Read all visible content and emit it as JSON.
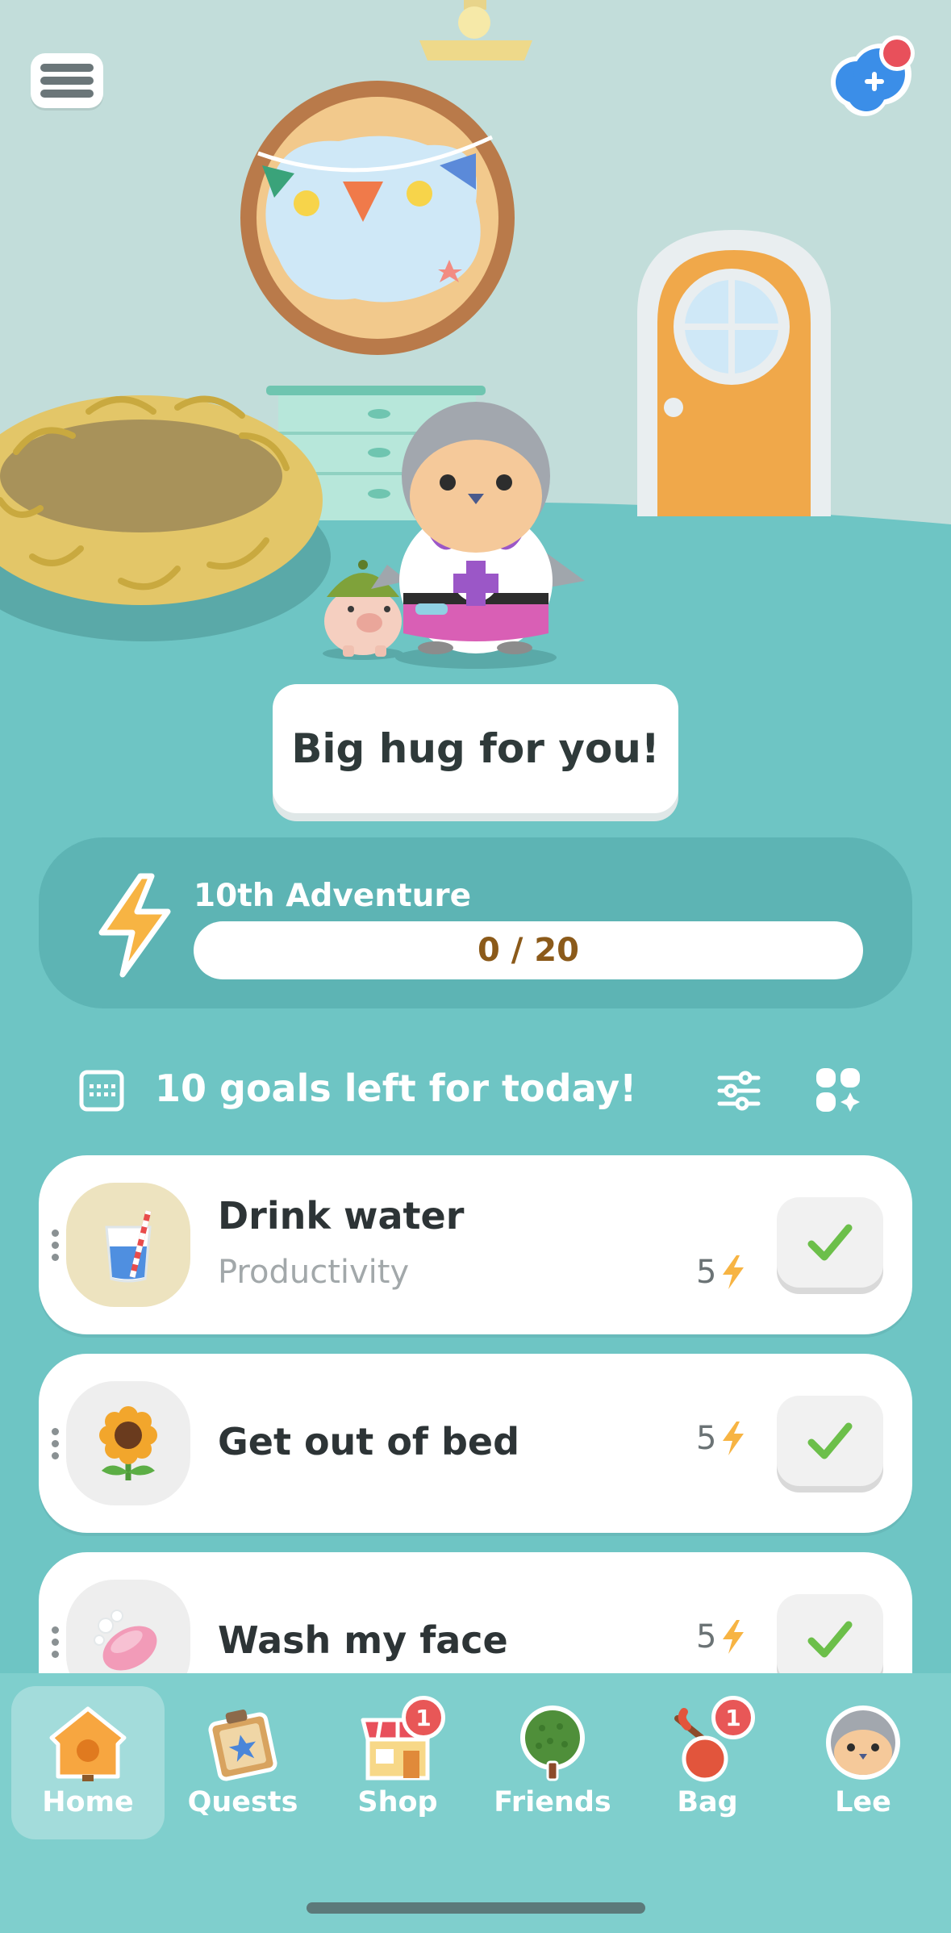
{
  "scene": {
    "speech_bubble": "Big hug for you!"
  },
  "adventure": {
    "title": "10th Adventure",
    "progress_label": "0 / 20",
    "progress_fraction": 0.0
  },
  "goals": {
    "header_text": "10 goals left for today!",
    "items": [
      {
        "name": "Drink water",
        "category": "Productivity",
        "points": "5",
        "icon": "water-glass-icon"
      },
      {
        "name": "Get out of bed",
        "category": "",
        "points": "5",
        "icon": "sunflower-icon"
      },
      {
        "name": "Wash my face",
        "category": "",
        "points": "5",
        "icon": "soap-icon"
      }
    ]
  },
  "tabbar": {
    "tabs": [
      {
        "label": "Home",
        "icon": "house-icon",
        "active": true
      },
      {
        "label": "Quests",
        "icon": "quest-map-icon"
      },
      {
        "label": "Shop",
        "icon": "shop-icon",
        "badge": "1"
      },
      {
        "label": "Friends",
        "icon": "tree-icon"
      },
      {
        "label": "Bag",
        "icon": "bag-icon",
        "badge": "1"
      },
      {
        "label": "Lee",
        "icon": "avatar-icon"
      }
    ]
  },
  "colors": {
    "background": "#6ec5c4",
    "wall": "#c2ddda",
    "accent_orange": "#f7b443",
    "check_green": "#6cbf4a"
  }
}
